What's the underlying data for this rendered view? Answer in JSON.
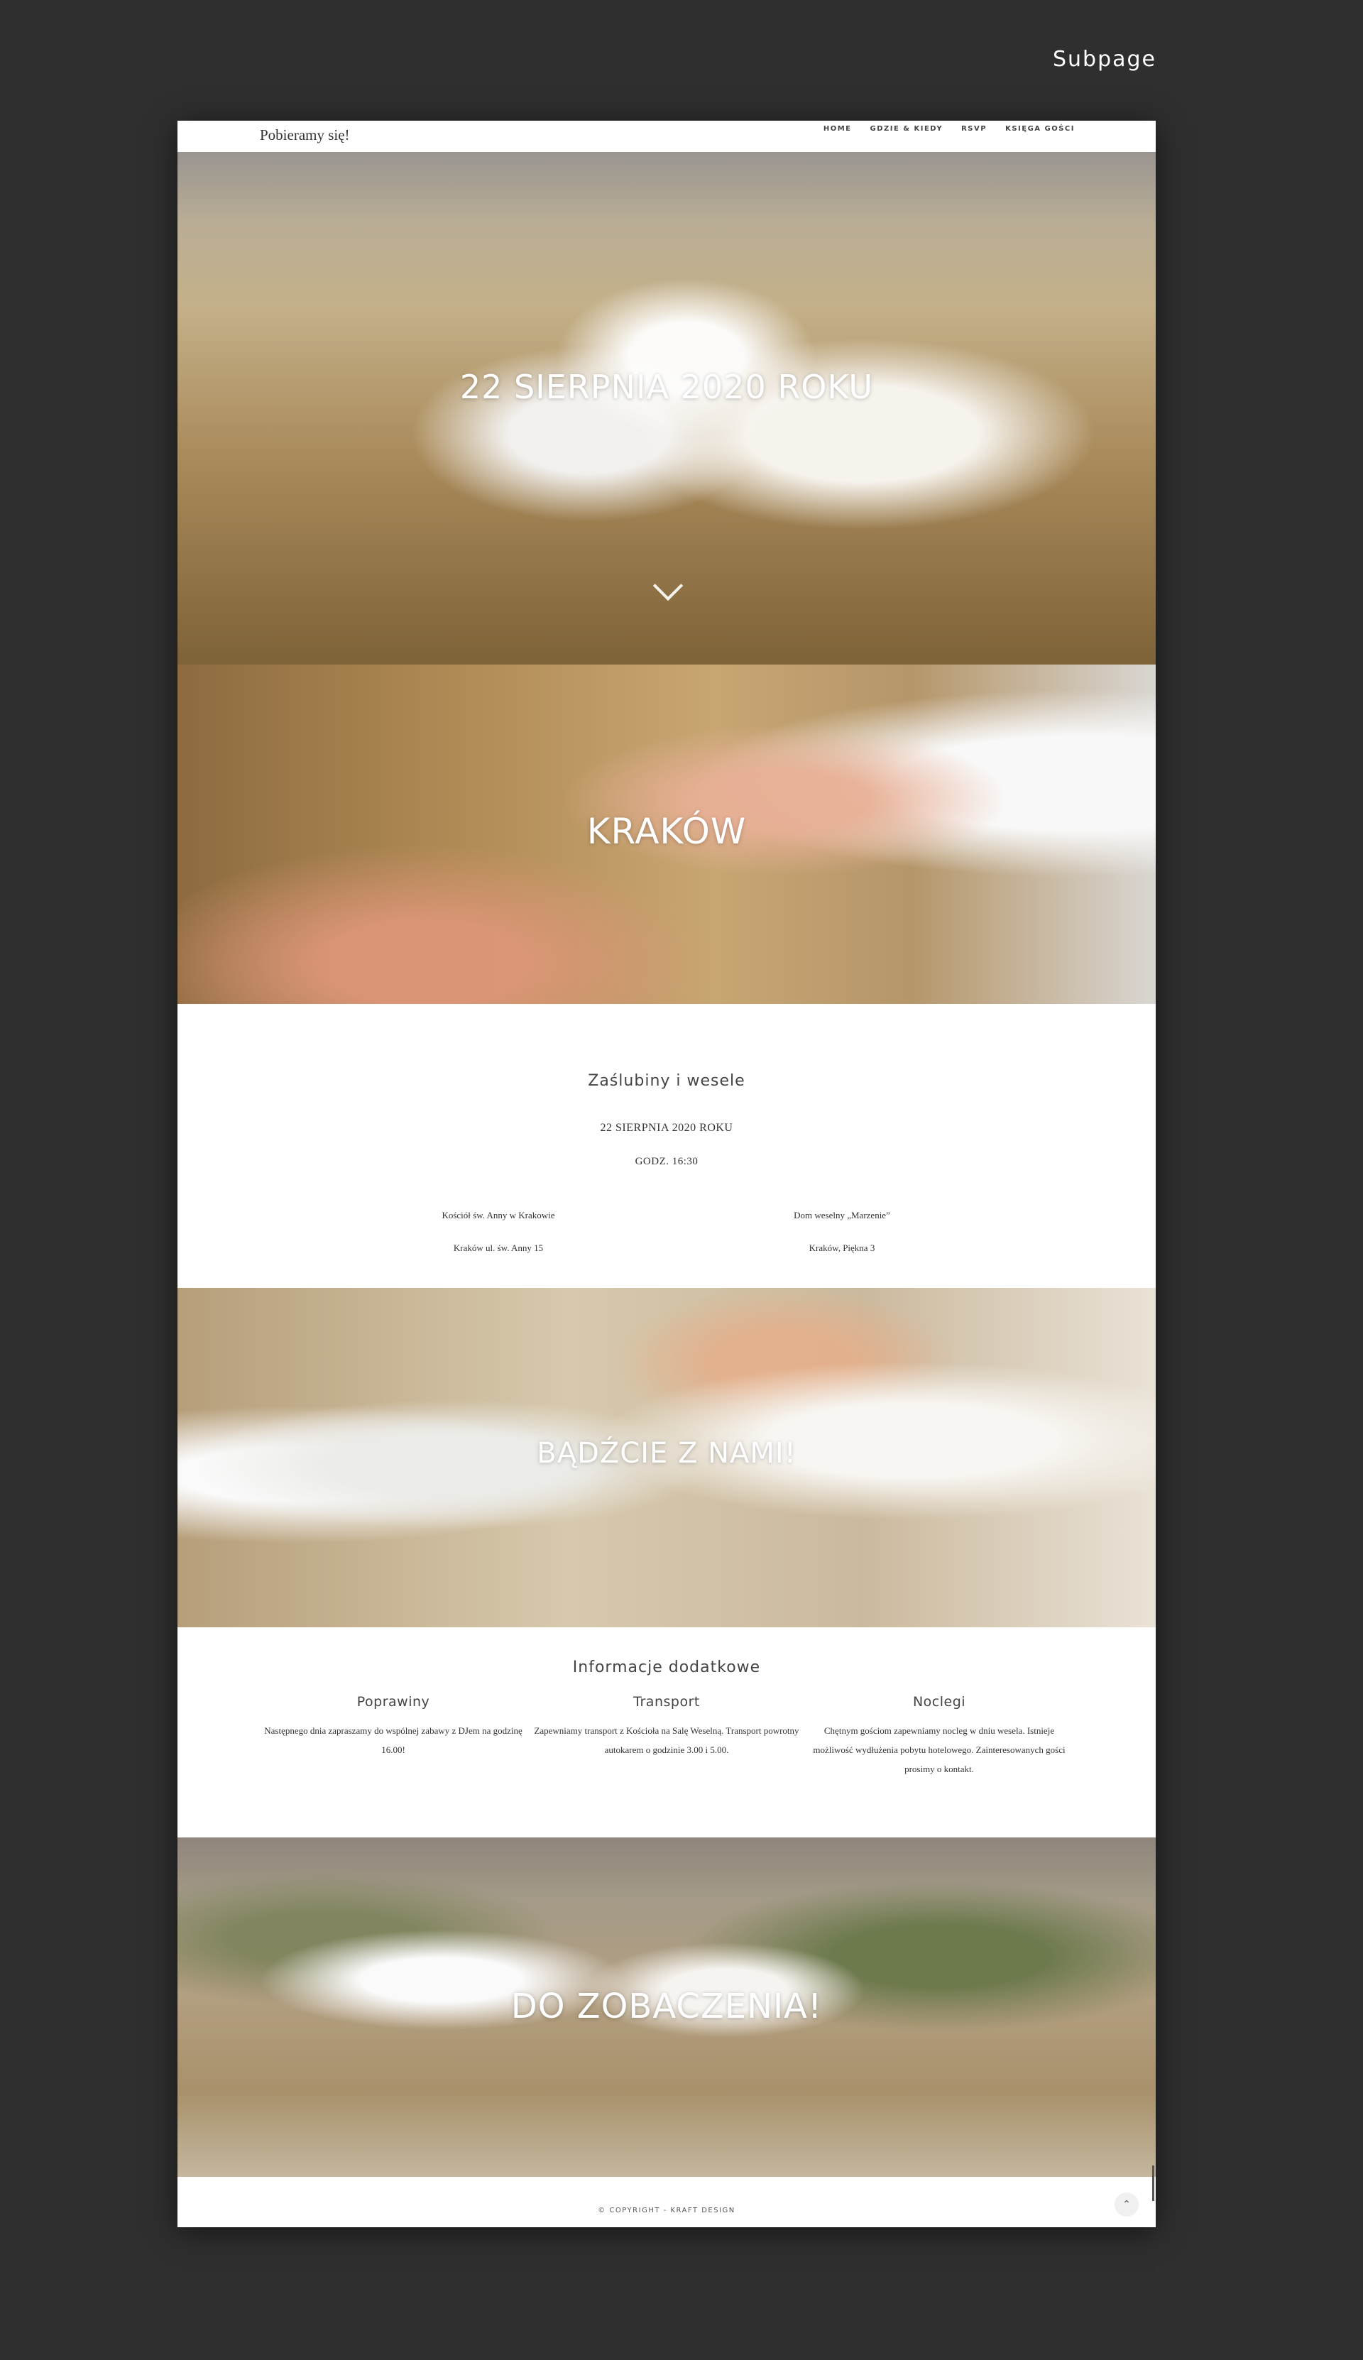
{
  "corner_label": "Subpage",
  "header": {
    "logo": "Pobieramy się!",
    "nav": [
      "HOME",
      "GDZIE & KIEDY",
      "RSVP",
      "KSIĘGA GOŚCI"
    ]
  },
  "hero": {
    "title": "22 SIERPNIA 2020 ROKU"
  },
  "city_section": {
    "title": "KRAKÓW"
  },
  "ceremony": {
    "heading": "Zaślubiny i wesele",
    "date": "22 SIERPNIA 2020 ROKU",
    "time": "GODZ. 16:30",
    "venues": [
      {
        "name": "Kościół św. Anny w Krakowie",
        "address": "Kraków ul. św. Anny 15"
      },
      {
        "name": "Dom weselny „Marzenie”",
        "address": "Kraków, Piękna 3"
      }
    ]
  },
  "join_section": {
    "title": "BĄDŹCIE Z NAMI!"
  },
  "additional": {
    "heading": "Informacje dodatkowe",
    "columns": [
      {
        "title": "Poprawiny",
        "text": "Następnego dnia zapraszamy do wspólnej zabawy z DJem na godzinę 16.00!"
      },
      {
        "title": "Transport",
        "text": "Zapewniamy transport z Kościoła na Salę Weselną. Transport powrotny autokarem o godzinie 3.00 i 5.00."
      },
      {
        "title": "Noclegi",
        "text": "Chętnym gościom zapewniamy nocleg w dniu wesela. Istnieje możliwość wydłużenia pobytu hotelowego. Zainteresowanych gości prosimy o kontakt."
      }
    ]
  },
  "farewell_section": {
    "title": "DO ZOBACZENIA!"
  },
  "footer": {
    "copyright": "© COPYRIGHT - KRAFT DESIGN",
    "to_top_icon": "chevron-up-icon"
  }
}
